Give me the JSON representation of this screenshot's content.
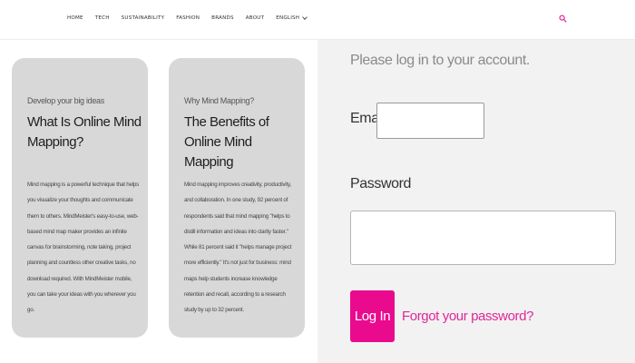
{
  "nav": {
    "items": [
      "HOME",
      "TECH",
      "SUSTAINABILITY",
      "FASHION",
      "BRANDS",
      "ABOUT"
    ],
    "language": "ENGLISH",
    "search_icon": "search-icon",
    "accent_color": "#e0279a"
  },
  "cards": [
    {
      "eyebrow": "Develop your big ideas",
      "title": "What Is Online Mind Mapping?",
      "body": "Mind mapping is a powerful technique that helps you visualize your thoughts and communicate them to others. MindMeister's easy-to-use, web-based mind map maker provides an infinite canvas for brainstorming, note taking, project planning and countless other creative tasks, no download required. With MindMeister mobile, you can take your ideas with you wherever you go."
    },
    {
      "eyebrow": "Why Mind Mapping?",
      "title": "The Benefits of Online Mind Mapping",
      "body": "Mind mapping improves creativity, productivity, and collaboration. In one study, 92 percent of respondents said that mind mapping \"helps to distill information and ideas into clarity faster.\" While 81 percent said it \"helps manage project more efficiently.\" It's not just for business: mind maps help students increase knowledge retention and recall, according to a research study by up to 32 percent."
    }
  ],
  "login": {
    "heading": "Please log in to your account.",
    "email_label": "Email",
    "email_value": "",
    "password_label": "Password",
    "password_value": "",
    "button_label": "Log In",
    "button_color": "#ea0a8e",
    "forgot_label": "Forgot your password?"
  }
}
